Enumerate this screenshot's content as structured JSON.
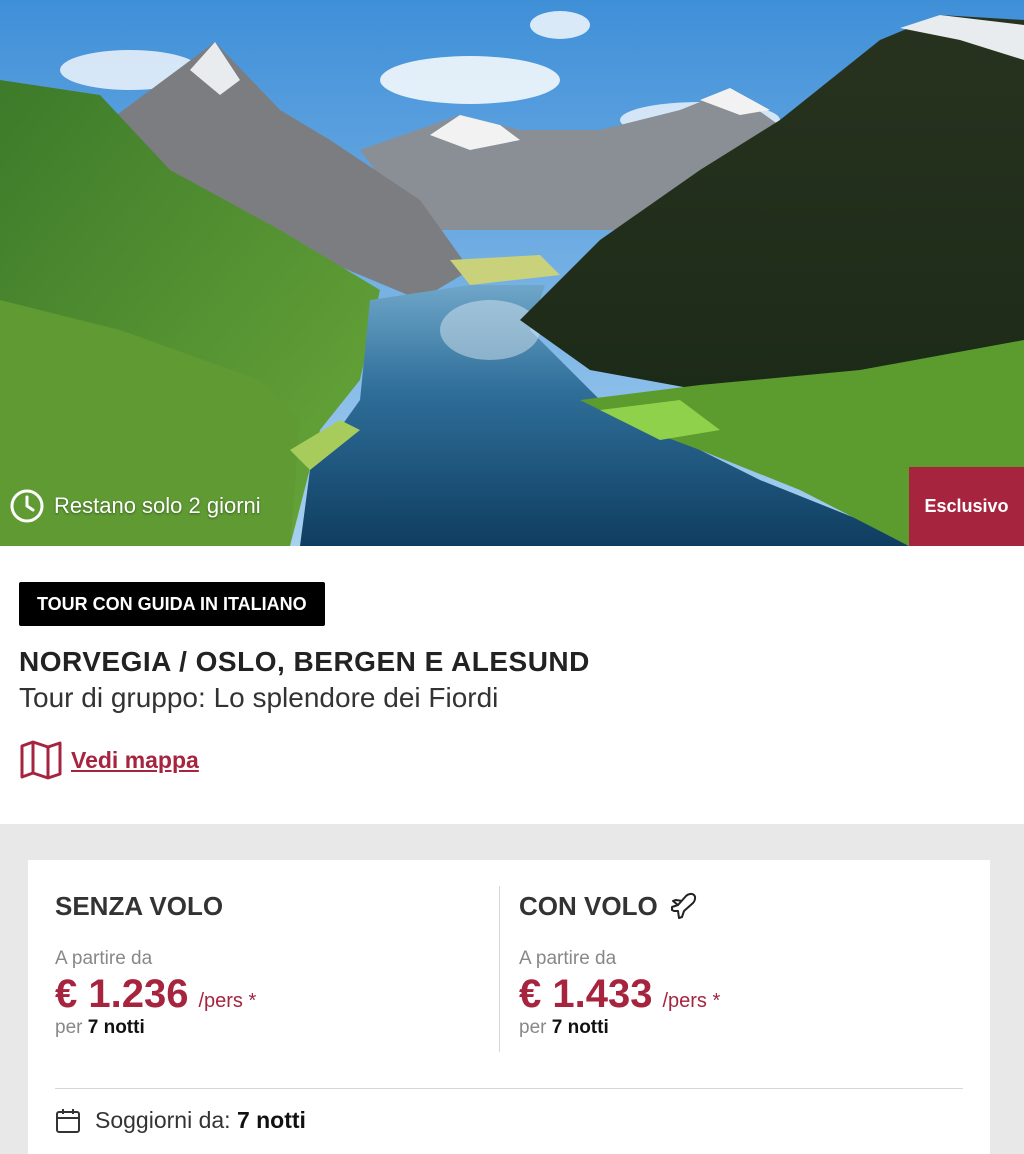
{
  "hero": {
    "countdown_text": "Restano solo 2 giorni",
    "countdown_icon": "clock-icon",
    "badge": "Esclusivo"
  },
  "tour": {
    "tag": "TOUR CON GUIDA IN ITALIANO",
    "title": "NORVEGIA / OSLO, BERGEN E ALESUND",
    "subtitle": "Tour di gruppo: Lo splendore dei Fiordi",
    "map_link": "Vedi mappa",
    "map_icon": "map-icon"
  },
  "pricing": {
    "without_flight": {
      "title": "SENZA VOLO",
      "from_label": "A partire da",
      "price": "€ 1.236",
      "per_person": "/pers *",
      "nights_prefix": "per",
      "nights": "7 notti"
    },
    "with_flight": {
      "title": "CON VOLO",
      "icon": "plane-icon",
      "from_label": "A partire da",
      "price": "€ 1.433",
      "per_person": "/pers *",
      "nights_prefix": "per",
      "nights": "7 notti"
    },
    "stay_label": "Soggiorni da:",
    "stay_value": "7 notti",
    "stay_icon": "calendar-icon"
  },
  "colors": {
    "accent": "#a7243f",
    "tag_bg": "#000000",
    "panel_bg": "#e8e8e8"
  }
}
